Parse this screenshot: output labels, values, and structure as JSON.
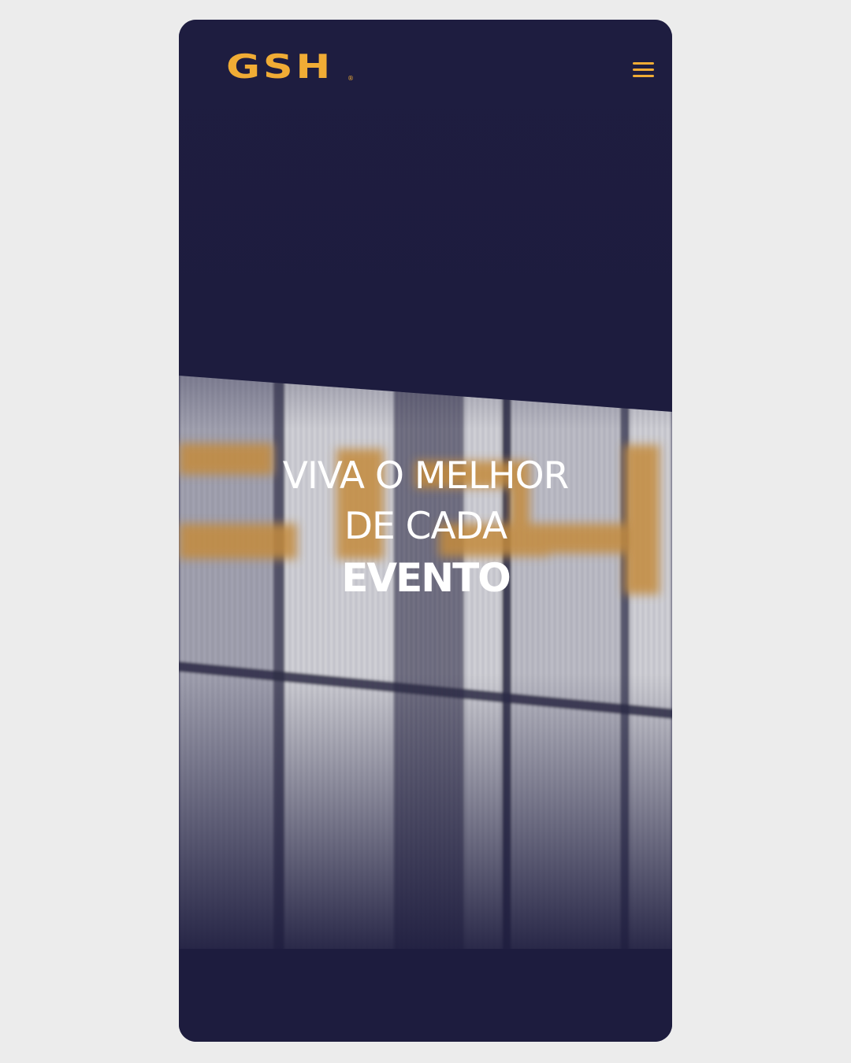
{
  "brand": {
    "logo_text": "GSH",
    "registered_mark": "®",
    "accent_color": "#f0ac35",
    "background_color": "#1d1c3e"
  },
  "header": {
    "menu_icon": "hamburger-menu-icon"
  },
  "hero": {
    "line1": "VIVA O MELHOR",
    "line2": "DE CADA",
    "line3": "EVENTO",
    "background_image": "blurred photo of a corrugated metal building facade with large GSH lettering"
  }
}
